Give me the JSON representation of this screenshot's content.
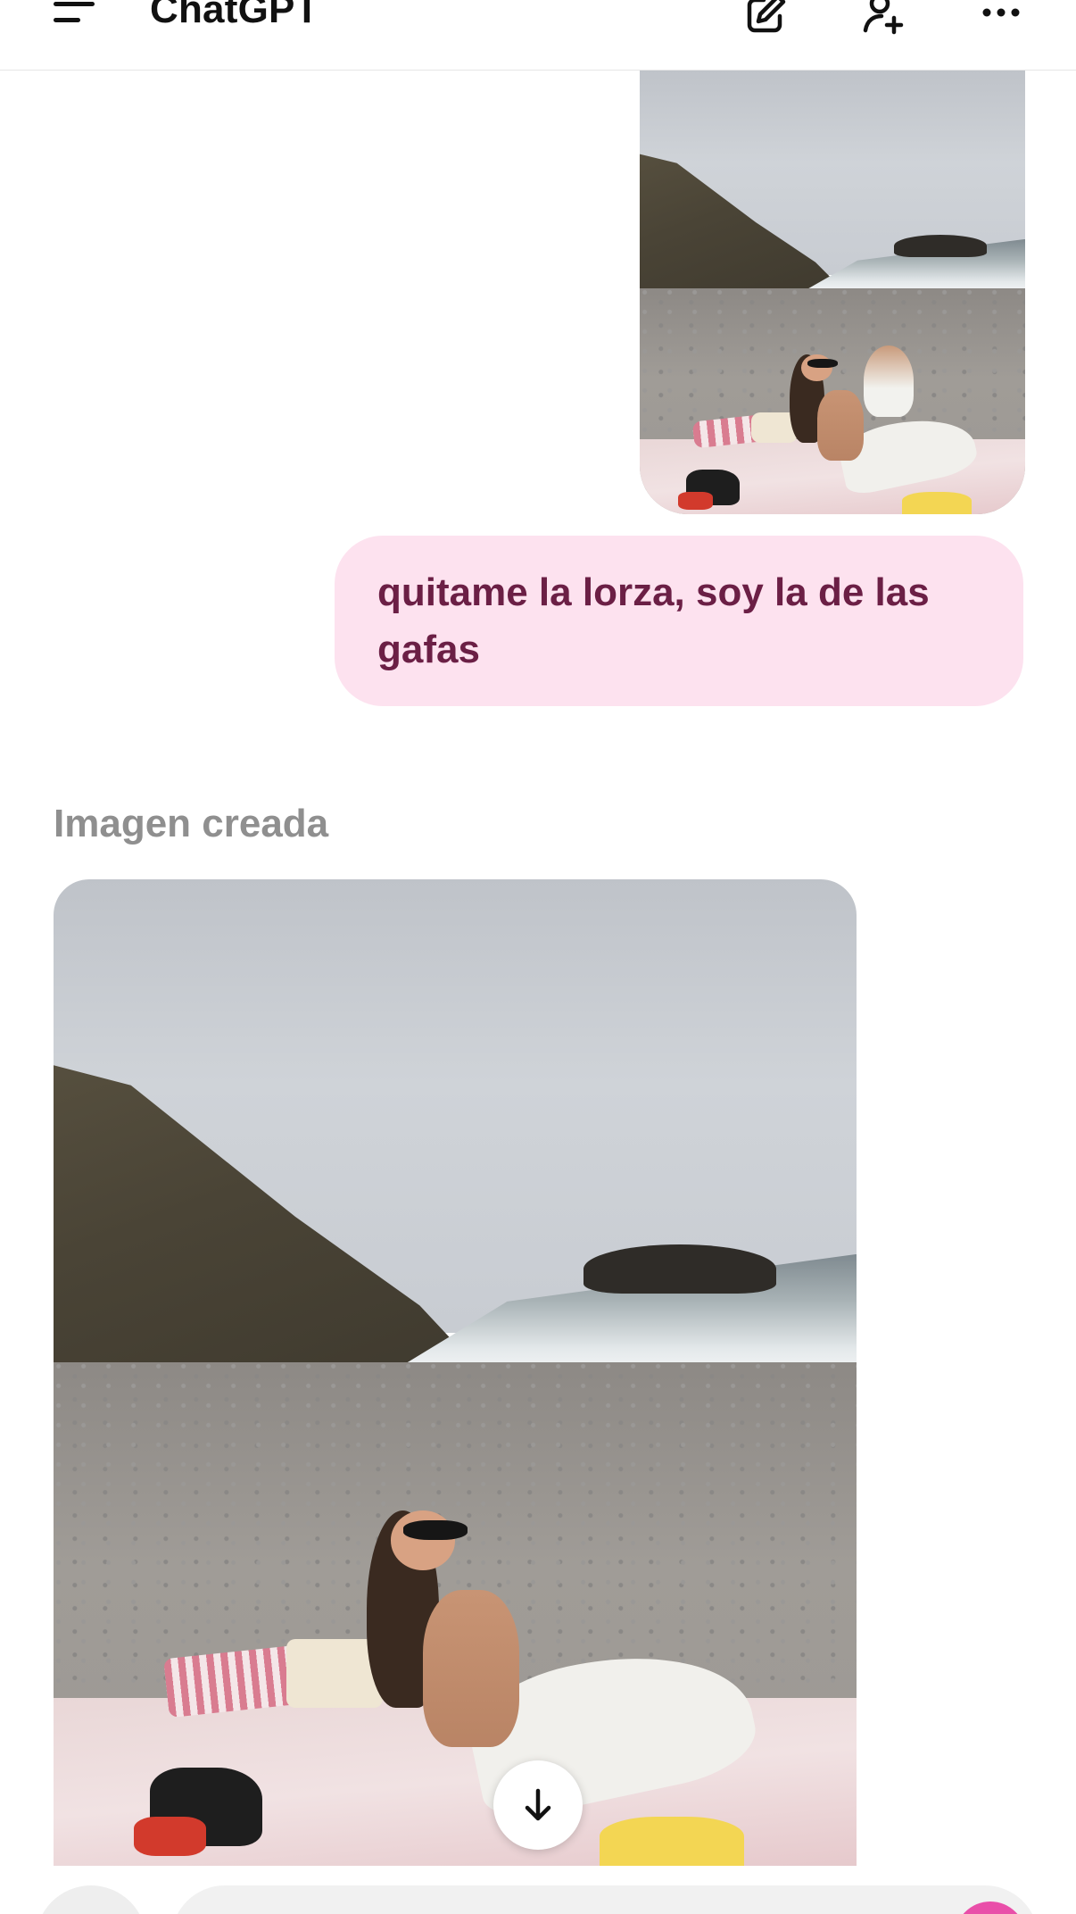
{
  "header": {
    "title": "ChatGPT",
    "icons": [
      "menu-icon",
      "edit-icon",
      "add-user-icon",
      "more-icon"
    ]
  },
  "conversation": {
    "user_message": "quitame la lorza, soy la de las gafas",
    "assistant_label": "Imagen creada"
  },
  "colors": {
    "bubble_bg": "#fde2ef",
    "bubble_text": "#6b1f45",
    "accent": "#e94fa9",
    "label_gray": "#8f8f8f"
  }
}
